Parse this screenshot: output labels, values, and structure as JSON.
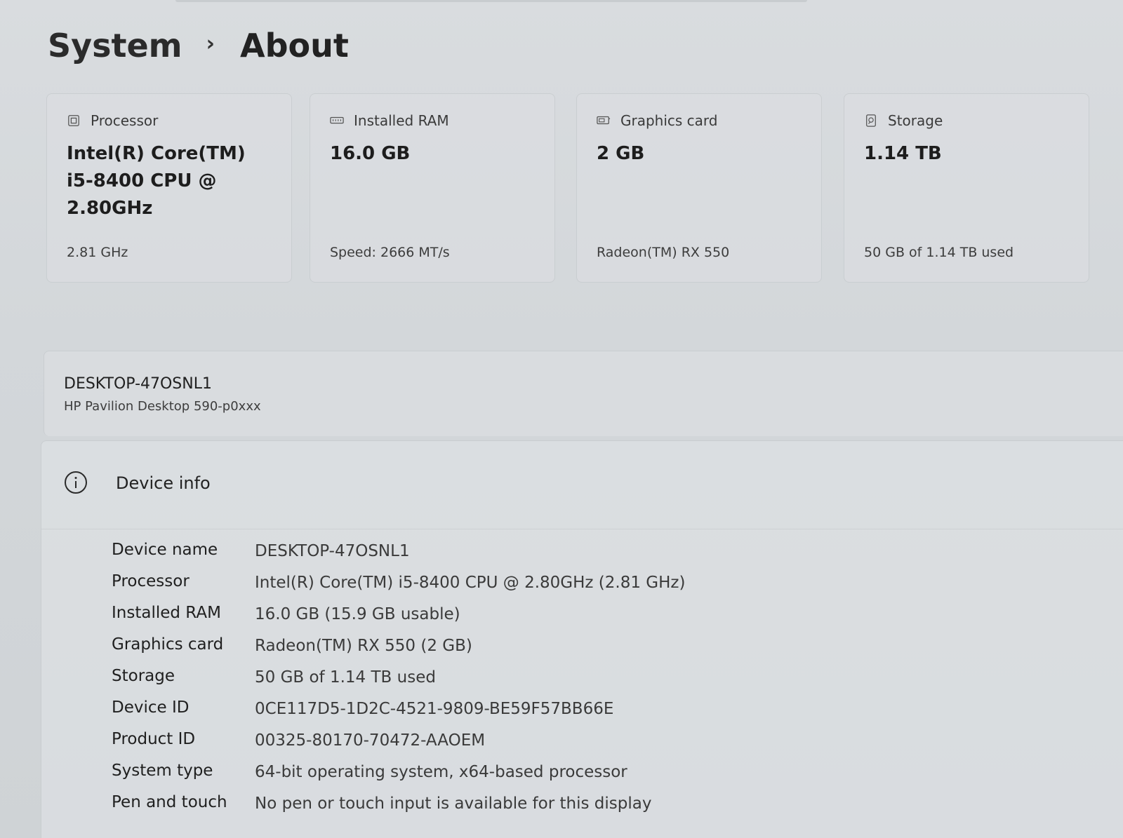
{
  "breadcrumb": {
    "parent": "System",
    "separator": "›",
    "current": "About"
  },
  "cards": [
    {
      "icon": "processor-icon",
      "label": "Processor",
      "value": "Intel(R) Core(TM) i5-8400 CPU @ 2.80GHz",
      "sub": "2.81 GHz"
    },
    {
      "icon": "ram-icon",
      "label": "Installed RAM",
      "value": "16.0 GB",
      "sub": "Speed: 2666 MT/s"
    },
    {
      "icon": "graphics-card-icon",
      "label": "Graphics card",
      "value": "2 GB",
      "sub": "Radeon(TM) RX 550"
    },
    {
      "icon": "storage-icon",
      "label": "Storage",
      "value": "1.14 TB",
      "sub": "50 GB of 1.14 TB used"
    }
  ],
  "device": {
    "name": "DESKTOP-47OSNL1",
    "model": "HP Pavilion Desktop 590-p0xxx"
  },
  "device_info": {
    "title": "Device info",
    "icon": "info-icon",
    "rows": [
      {
        "label": "Device name",
        "value": "DESKTOP-47OSNL1"
      },
      {
        "label": "Processor",
        "value": "Intel(R) Core(TM) i5-8400 CPU @ 2.80GHz (2.81 GHz)"
      },
      {
        "label": "Installed RAM",
        "value": "16.0 GB (15.9 GB usable)"
      },
      {
        "label": "Graphics card",
        "value": "Radeon(TM) RX 550 (2 GB)"
      },
      {
        "label": "Storage",
        "value": "50 GB of 1.14 TB used"
      },
      {
        "label": "Device ID",
        "value": "0CE117D5-1D2C-4521-9809-BE59F57BB66E"
      },
      {
        "label": "Product ID",
        "value": "00325-80170-70472-AAOEM"
      },
      {
        "label": "System type",
        "value": "64-bit operating system, x64-based processor"
      },
      {
        "label": "Pen and touch",
        "value": "No pen or touch input is available for this display"
      }
    ]
  }
}
